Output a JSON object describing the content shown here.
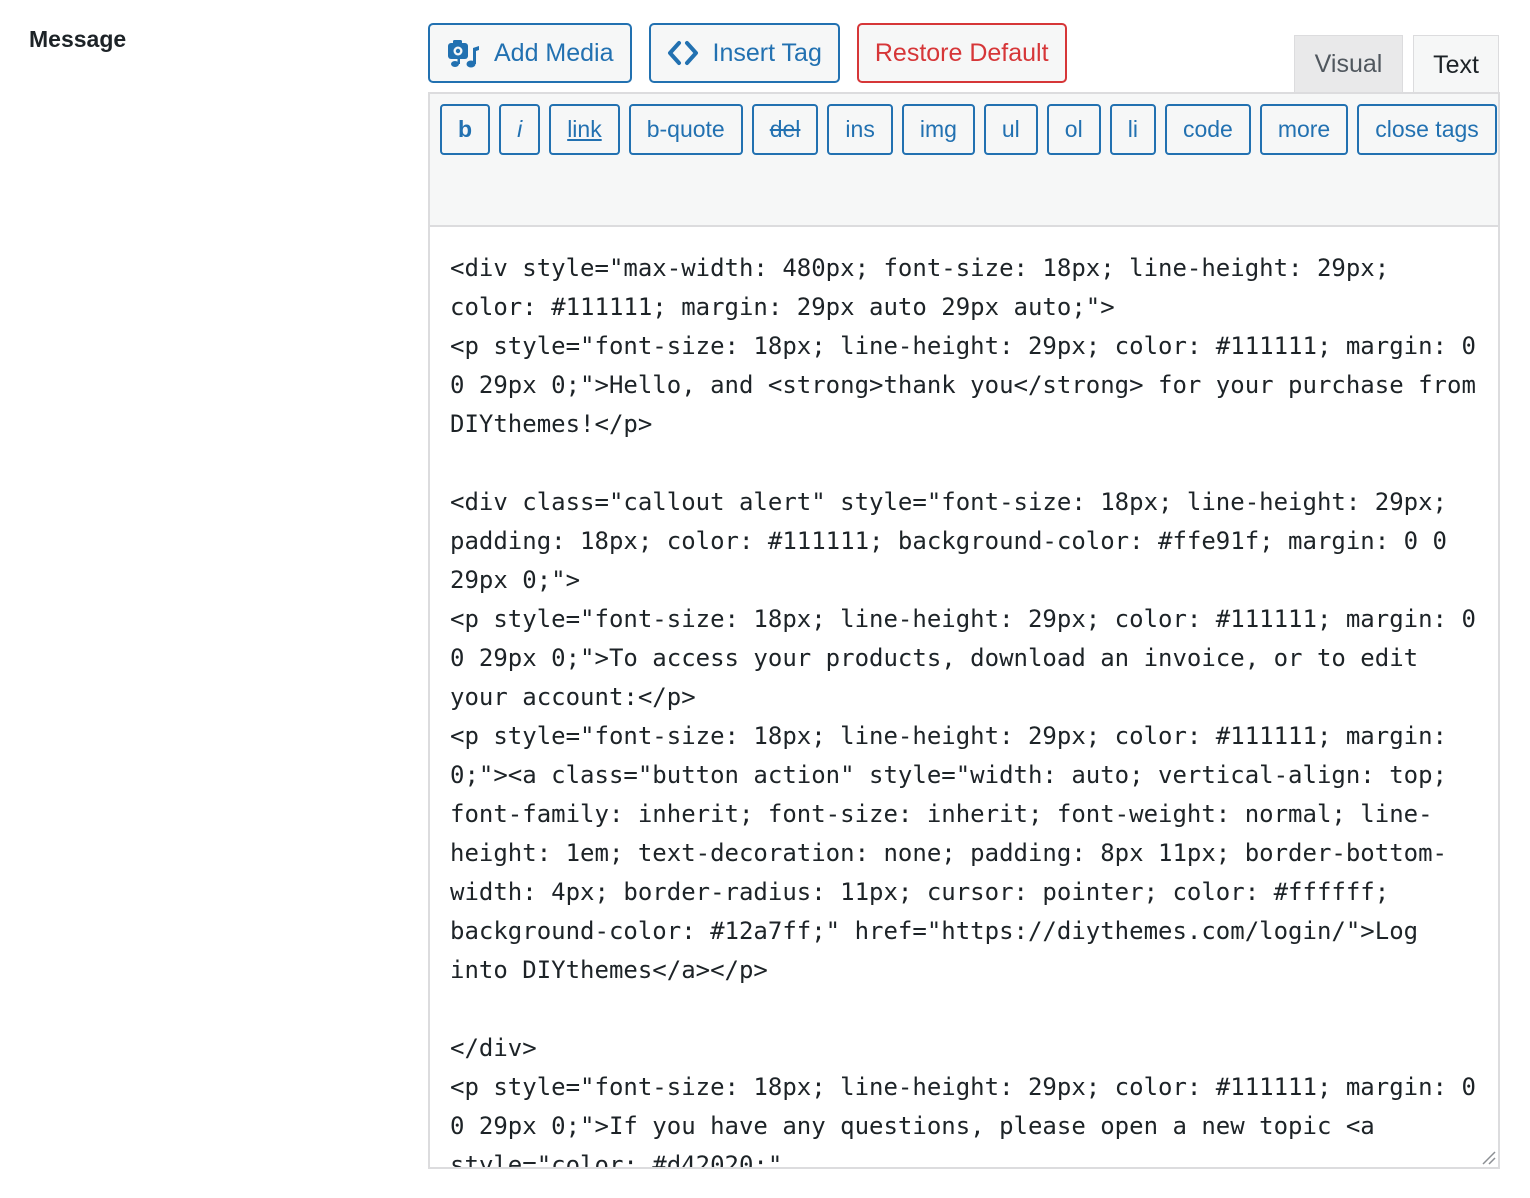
{
  "field": {
    "label": "Message"
  },
  "media_buttons": {
    "add_media": "Add Media",
    "insert_tag": "Insert Tag",
    "restore_default": "Restore Default"
  },
  "tabs": {
    "visual": "Visual",
    "text": "Text",
    "active": "Text"
  },
  "quicktags": [
    "b",
    "i",
    "link",
    "b-quote",
    "del",
    "ins",
    "img",
    "ul",
    "ol",
    "li",
    "code",
    "more",
    "close tags"
  ],
  "editor": {
    "content": "<div style=\"max-width: 480px; font-size: 18px; line-height: 29px; color: #111111; margin: 29px auto 29px auto;\">\n<p style=\"font-size: 18px; line-height: 29px; color: #111111; margin: 0 0 29px 0;\">Hello, and <strong>thank you</strong> for your purchase from DIYthemes!</p>\n\n<div class=\"callout alert\" style=\"font-size: 18px; line-height: 29px; padding: 18px; color: #111111; background-color: #ffe91f; margin: 0 0 29px 0;\">\n<p style=\"font-size: 18px; line-height: 29px; color: #111111; margin: 0 0 29px 0;\">To access your products, download an invoice, or to edit your account:</p>\n<p style=\"font-size: 18px; line-height: 29px; color: #111111; margin: 0;\"><a class=\"button action\" style=\"width: auto; vertical-align: top; font-family: inherit; font-size: inherit; font-weight: normal; line-height: 1em; text-decoration: none; padding: 8px 11px; border-bottom-width: 4px; border-radius: 11px; cursor: pointer; color: #ffffff; background-color: #12a7ff;\" href=\"https://diythemes.com/login/\">Log into DIYthemes</a></p>\n\n</div>\n<p style=\"font-size: 18px; line-height: 29px; color: #111111; margin: 0 0 29px 0;\">If you have any questions, please open a new topic <a style=\"color: #d42020;\""
  },
  "colors": {
    "accent": "#2271b1",
    "danger": "#d63638",
    "toolbar_bg": "#f6f7f7",
    "border": "#dcdcde"
  }
}
